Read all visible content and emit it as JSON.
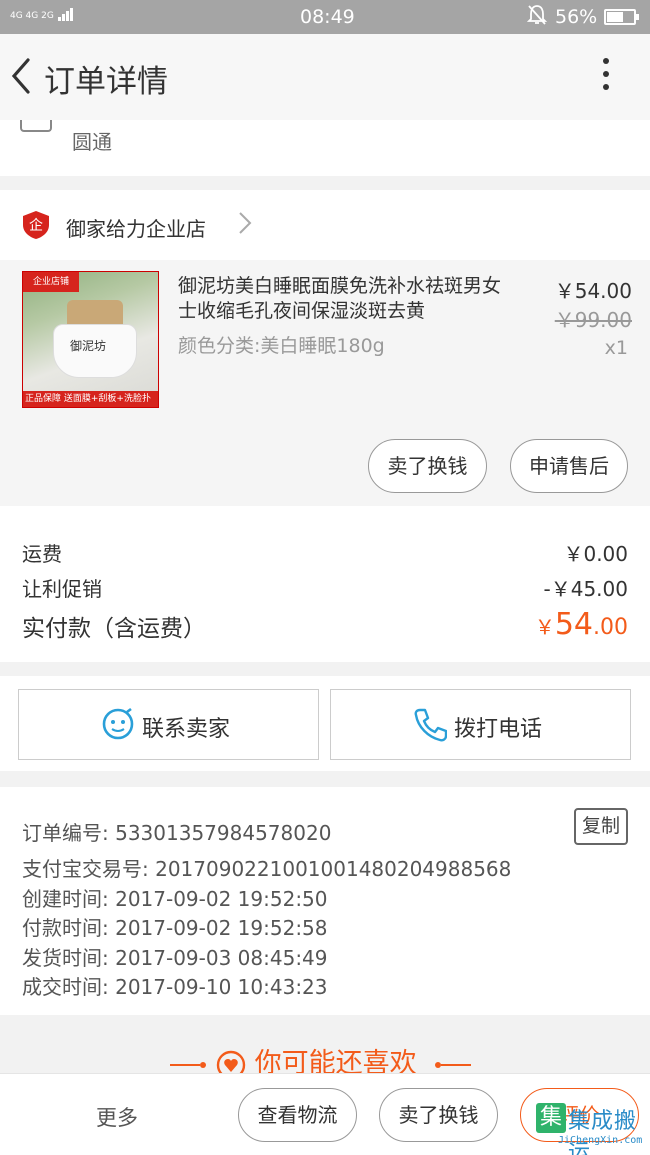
{
  "status_bar": {
    "signal": "4G 4G 2G",
    "time": "08:49",
    "battery": "56%"
  },
  "header": {
    "title": "订单详情"
  },
  "logistics": {
    "company": "圆通"
  },
  "shop": {
    "name": "御家给力企业店",
    "badge_text": "企"
  },
  "product": {
    "name": "御泥坊美白睡眠面膜免洗补水祛斑男女士收缩毛孔夜间保湿淡斑去黄",
    "spec": "颜色分类:美白睡眠180g",
    "price": "￥54.00",
    "original_price": "￥99.00",
    "quantity": "x1",
    "image": {
      "corner_tag": "企业店铺",
      "jar_label": "御泥坊",
      "bottom_strip": "正品保障 送面膜+刮板+洗脸扑"
    },
    "actions": {
      "sell": "卖了换钱",
      "after_sale": "申请售后"
    }
  },
  "summary": {
    "shipping_label": "运费",
    "shipping_value": "￥0.00",
    "discount_label": "让利促销",
    "discount_value": "-￥45.00",
    "paid_label": "实付款（含运费）",
    "paid_yen": "￥",
    "paid_int": "54",
    "paid_dec": ".00"
  },
  "contact": {
    "seller": "联系卖家",
    "phone": "拨打电话"
  },
  "order_info": {
    "order_no": "订单编号: 53301357984578020",
    "alipay_no": "支付宝交易号: 2017090221001001480204988568",
    "created": "创建时间: 2017-09-02 19:52:50",
    "paid": "付款时间: 2017-09-02 19:52:58",
    "shipped": "发货时间: 2017-09-03 08:45:49",
    "completed": "成交时间: 2017-09-10 10:43:23",
    "copy": "复制"
  },
  "recommend": {
    "title": "你可能还喜欢"
  },
  "bottom_bar": {
    "more": "更多",
    "logistics": "查看物流",
    "sell": "卖了换钱",
    "rate": "评价"
  },
  "watermark": {
    "text": "集成搬运",
    "logo": "集",
    "url": "JiChengXin.com"
  },
  "colors": {
    "accent": "#f35b1a",
    "shop_badge": "#d6241d",
    "contact_icon": "#2a9fd8",
    "status_bar": "#a5a5a5"
  }
}
